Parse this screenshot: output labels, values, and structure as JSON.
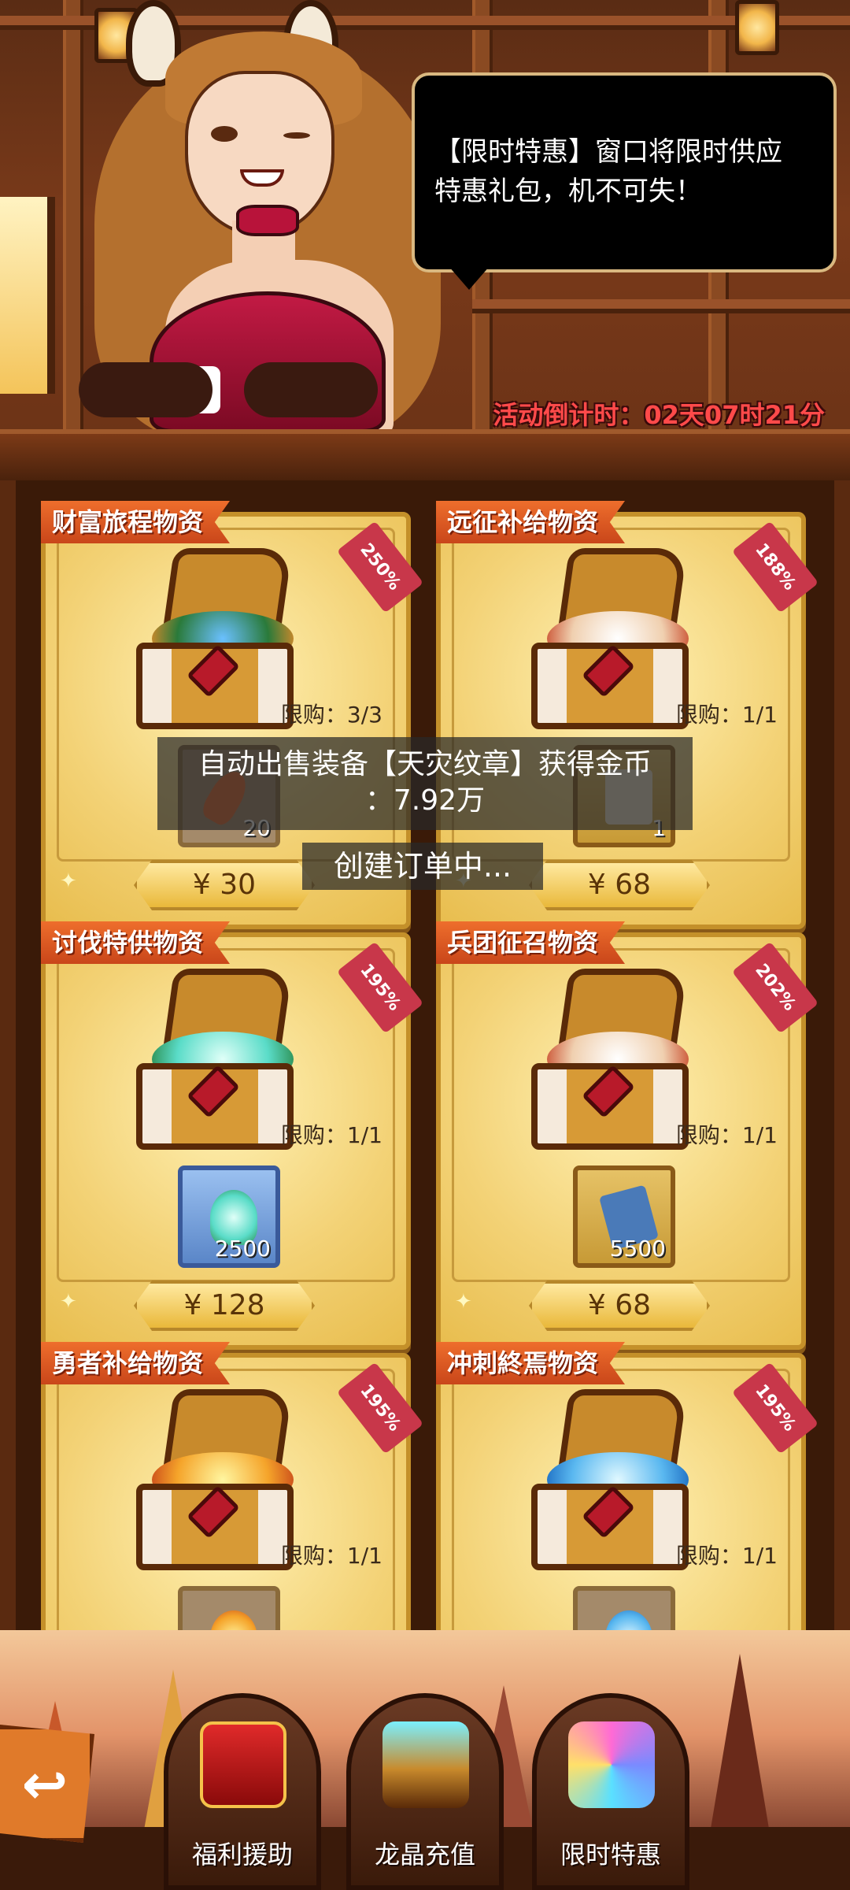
{
  "speech_bubble": {
    "line1": "【限时特惠】窗口将限时供应",
    "line2": "特惠礼包，机不可失！"
  },
  "countdown": "活动倒计时：02天07时21分",
  "packs": [
    {
      "title": "财富旅程物资",
      "discount": "250%",
      "limit": "限购：3/3",
      "reward_count": "20",
      "price": "¥ 30"
    },
    {
      "title": "远征补给物资",
      "discount": "188%",
      "limit": "限购：1/1",
      "reward_count": "1",
      "price": "¥ 68"
    },
    {
      "title": "讨伐特供物资",
      "discount": "195%",
      "limit": "限购：1/1",
      "reward_count": "2500",
      "price": "¥ 128"
    },
    {
      "title": "兵团征召物资",
      "discount": "202%",
      "limit": "限购：1/1",
      "reward_count": "5500",
      "price": "¥ 68"
    },
    {
      "title": "勇者补给物资",
      "discount": "195%",
      "limit": "限购：1/1",
      "reward_count": "",
      "price": ""
    },
    {
      "title": "冲刺終焉物资",
      "discount": "195%",
      "limit": "限购：1/1",
      "reward_count": "",
      "price": ""
    }
  ],
  "toast": {
    "line1": "自动出售装备【天灾纹章】获得金币",
    "line2": "：7.92万"
  },
  "loading_text": "创建订单中...",
  "bottom_nav": [
    {
      "label": "福利援助",
      "icon": "red-envelope-icon"
    },
    {
      "label": "龙晶充值",
      "icon": "crystal-chest-icon"
    },
    {
      "label": "限时特惠",
      "icon": "gem-gift-icon"
    }
  ],
  "icons": {
    "back": "back-arrow-icon"
  },
  "colors": {
    "accent_red": "#c8374a",
    "title_orange": "#ee6e2c",
    "countdown_red": "#ff4a4a",
    "card_gold": "#f3d276"
  }
}
